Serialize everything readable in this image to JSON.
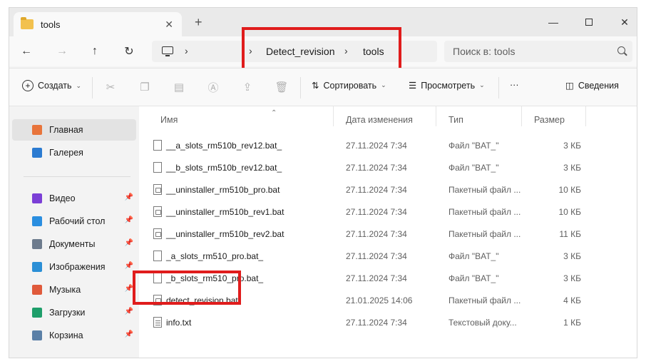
{
  "window": {
    "tab_title": "tools",
    "new_tab_symbol": "+",
    "tab_close_symbol": "✕",
    "minimize_symbol": "—",
    "close_symbol": "✕"
  },
  "nav": {
    "back": "←",
    "forward": "→",
    "up": "↑",
    "refresh": "↻",
    "chevron": "›",
    "breadcrumbs": [
      "Detect_revision",
      "tools"
    ],
    "search_placeholder": "Поиск в: tools"
  },
  "toolbar": {
    "create": "Создать",
    "sort": "Сортировать",
    "view": "Просмотреть",
    "more": "···",
    "details": "Сведения"
  },
  "sidebar": {
    "items": [
      {
        "label": "Главная",
        "icon": "home-icon",
        "color": "#e8743b"
      },
      {
        "label": "Галерея",
        "icon": "gallery-icon",
        "color": "#2b7bd1"
      },
      {
        "label": "Видео",
        "icon": "video-icon",
        "color": "#7b3fd6"
      },
      {
        "label": "Рабочий стол",
        "icon": "desktop-icon",
        "color": "#2a8ee0"
      },
      {
        "label": "Документы",
        "icon": "documents-icon",
        "color": "#6d7b8d"
      },
      {
        "label": "Изображения",
        "icon": "pictures-icon",
        "color": "#2b8fd6"
      },
      {
        "label": "Музыка",
        "icon": "music-icon",
        "color": "#e05a3b"
      },
      {
        "label": "Загрузки",
        "icon": "downloads-icon",
        "color": "#1e9e6a"
      },
      {
        "label": "Корзина",
        "icon": "recycle-bin-icon",
        "color": "#5a7fa6"
      }
    ]
  },
  "columns": {
    "name": "Имя",
    "date": "Дата изменения",
    "type": "Тип",
    "size": "Размер"
  },
  "files": [
    {
      "name": "__a_slots_rm510b_rev12.bat_",
      "date": "27.11.2024 7:34",
      "type": "Файл \"BAT_\"",
      "size": "3 КБ",
      "kind": "blank"
    },
    {
      "name": "__b_slots_rm510b_rev12.bat_",
      "date": "27.11.2024 7:34",
      "type": "Файл \"BAT_\"",
      "size": "3 КБ",
      "kind": "blank"
    },
    {
      "name": "__uninstaller_rm510b_pro.bat",
      "date": "27.11.2024 7:34",
      "type": "Пакетный файл ...",
      "size": "10 КБ",
      "kind": "bat"
    },
    {
      "name": "__uninstaller_rm510b_rev1.bat",
      "date": "27.11.2024 7:34",
      "type": "Пакетный файл ...",
      "size": "10 КБ",
      "kind": "bat"
    },
    {
      "name": "__uninstaller_rm510b_rev2.bat",
      "date": "27.11.2024 7:34",
      "type": "Пакетный файл ...",
      "size": "11 КБ",
      "kind": "bat"
    },
    {
      "name": "_a_slots_rm510_pro.bat_",
      "date": "27.11.2024 7:34",
      "type": "Файл \"BAT_\"",
      "size": "3 КБ",
      "kind": "blank"
    },
    {
      "name": "_b_slots_rm510_pro.bat_",
      "date": "27.11.2024 7:34",
      "type": "Файл \"BAT_\"",
      "size": "3 КБ",
      "kind": "blank"
    },
    {
      "name": "detect_revision.bat",
      "date": "21.01.2025 14:06",
      "type": "Пакетный файл ...",
      "size": "4 КБ",
      "kind": "bat"
    },
    {
      "name": "info.txt",
      "date": "27.11.2024 7:34",
      "type": "Текстовый доку...",
      "size": "1 КБ",
      "kind": "txt"
    }
  ],
  "highlight_color": "#e01c1c"
}
